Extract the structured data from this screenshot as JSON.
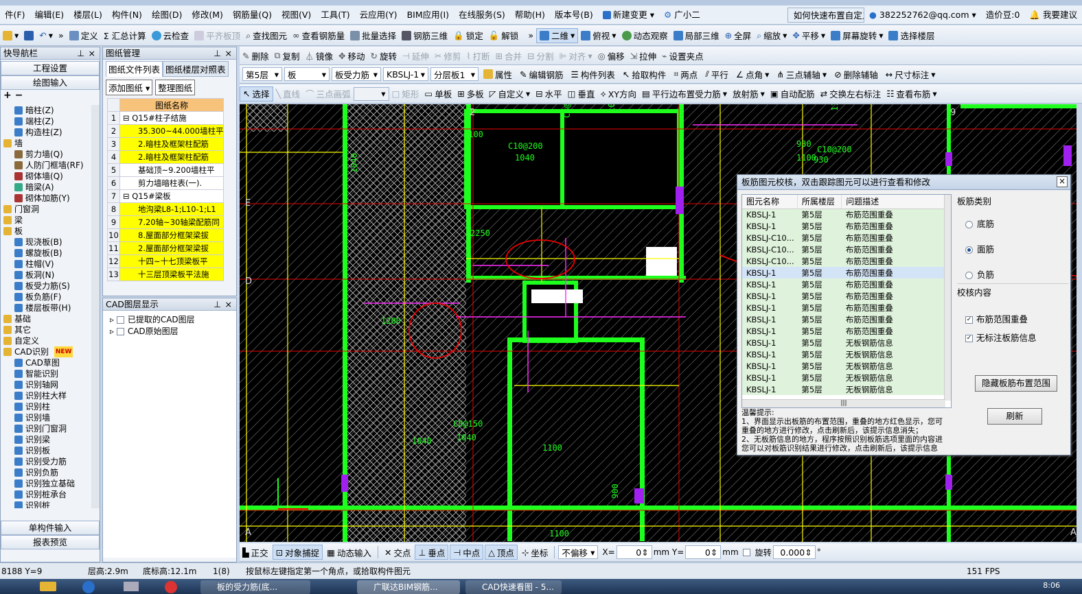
{
  "menu": [
    "件(F)",
    "编辑(E)",
    "楼层(L)",
    "构件(N)",
    "绘图(D)",
    "修改(M)",
    "钢筋量(Q)",
    "视图(V)",
    "工具(T)",
    "云应用(Y)",
    "BIM应用(I)",
    "在线服务(S)",
    "帮助(H)",
    "版本号(B)"
  ],
  "menu_extra": {
    "new_change": "新建变更",
    "assistant": "广小二",
    "tip": "如何快速布置自定义范...",
    "account": "382252762@qq.com",
    "price": "造价豆:0",
    "search": "我要建议"
  },
  "toolbar1": [
    "定义",
    "Σ 汇总计算",
    "云检查",
    "平齐板顶",
    "查找图元",
    "查看钢筋量",
    "批量选择",
    "钢筋三维",
    "锁定",
    "解锁",
    "二维",
    "俯视",
    "动态观察",
    "局部三维",
    "全屏",
    "缩放",
    "平移",
    "屏幕旋转",
    "选择楼层"
  ],
  "toolbar2": [
    "删除",
    "复制",
    "镜像",
    "移动",
    "旋转",
    "延伸",
    "修剪",
    "打断",
    "合并",
    "分割",
    "对齐",
    "偏移",
    "拉伸",
    "设置夹点"
  ],
  "toolbar3": {
    "floor": "第5层",
    "type": "板",
    "subtype": "板受力筋",
    "name": "KBSLJ-1",
    "layer": "分层板1",
    "buttons": [
      "属性",
      "编辑钢筋",
      "构件列表",
      "拾取构件",
      "两点",
      "平行",
      "点角",
      "三点辅轴",
      "删除辅轴",
      "尺寸标注"
    ]
  },
  "toolbar4": [
    "选择",
    "直线",
    "三点画弧",
    "矩形",
    "单板",
    "多板",
    "自定义",
    "水平",
    "垂直",
    "XY方向",
    "平行边布置受力筋",
    "放射筋",
    "自动配筋",
    "交换左右标注",
    "查看布筋"
  ],
  "nav": {
    "title": "快导航栏",
    "btn1": "工程设置",
    "btn2": "绘图输入",
    "btn3": "单构件输入",
    "btn4": "报表预览",
    "tree": [
      {
        "t": "暗柱(Z)",
        "l": 2,
        "c": "#3b7dc8"
      },
      {
        "t": "端柱(Z)",
        "l": 2,
        "c": "#3b7dc8"
      },
      {
        "t": "构造柱(Z)",
        "l": 2,
        "c": "#3b7dc8"
      },
      {
        "t": "墙",
        "l": 0,
        "c": "#e5b435"
      },
      {
        "t": "剪力墙(Q)",
        "l": 2,
        "c": "#8a6a3c"
      },
      {
        "t": "人防门框墙(RF)",
        "l": 2,
        "c": "#8a6a3c"
      },
      {
        "t": "砌体墙(Q)",
        "l": 2,
        "c": "#a33"
      },
      {
        "t": "暗梁(A)",
        "l": 2,
        "c": "#3a8"
      },
      {
        "t": "砌体加筋(Y)",
        "l": 2,
        "c": "#a33"
      },
      {
        "t": "门窗洞",
        "l": 0,
        "c": "#e5b435"
      },
      {
        "t": "梁",
        "l": 0,
        "c": "#e5b435"
      },
      {
        "t": "板",
        "l": 0,
        "c": "#e5b435"
      },
      {
        "t": "现浇板(B)",
        "l": 2,
        "c": "#3b7dc8"
      },
      {
        "t": "螺旋板(B)",
        "l": 2,
        "c": "#3b7dc8"
      },
      {
        "t": "柱帽(V)",
        "l": 2,
        "c": "#3b7dc8"
      },
      {
        "t": "板洞(N)",
        "l": 2,
        "c": "#3b7dc8"
      },
      {
        "t": "板受力筋(S)",
        "l": 2,
        "c": "#3b7dc8"
      },
      {
        "t": "板负筋(F)",
        "l": 2,
        "c": "#3b7dc8"
      },
      {
        "t": "楼层板带(H)",
        "l": 2,
        "c": "#3b7dc8"
      },
      {
        "t": "基础",
        "l": 0,
        "c": "#e5b435"
      },
      {
        "t": "其它",
        "l": 0,
        "c": "#e5b435"
      },
      {
        "t": "自定义",
        "l": 0,
        "c": "#e5b435"
      },
      {
        "t": "CAD识别",
        "l": 0,
        "c": "#e5b435",
        "badge": "NEW"
      },
      {
        "t": "CAD草图",
        "l": 2,
        "c": "#3b7dc8"
      },
      {
        "t": "智能识别",
        "l": 2,
        "c": "#3b7dc8"
      },
      {
        "t": "识别轴网",
        "l": 2,
        "c": "#3b7dc8"
      },
      {
        "t": "识别柱大样",
        "l": 2,
        "c": "#3b7dc8"
      },
      {
        "t": "识别柱",
        "l": 2,
        "c": "#3b7dc8"
      },
      {
        "t": "识别墙",
        "l": 2,
        "c": "#3b7dc8"
      },
      {
        "t": "识别门窗洞",
        "l": 2,
        "c": "#3b7dc8"
      },
      {
        "t": "识别梁",
        "l": 2,
        "c": "#3b7dc8"
      },
      {
        "t": "识别板",
        "l": 2,
        "c": "#3b7dc8"
      },
      {
        "t": "识别受力筋",
        "l": 2,
        "c": "#3b7dc8"
      },
      {
        "t": "识别负筋",
        "l": 2,
        "c": "#3b7dc8"
      },
      {
        "t": "识别独立基础",
        "l": 2,
        "c": "#3b7dc8"
      },
      {
        "t": "识别桩承台",
        "l": 2,
        "c": "#3b7dc8"
      },
      {
        "t": "识别桩",
        "l": 2,
        "c": "#3b7dc8"
      }
    ]
  },
  "drawings": {
    "title": "图纸管理",
    "tab1": "图纸文件列表",
    "tab2": "图纸楼层对照表",
    "add": "添加图纸",
    "organize": "整理图纸",
    "col": "图纸名称",
    "rows": [
      {
        "n": "1",
        "t": "Q15#柱子结施",
        "g": true
      },
      {
        "n": "2",
        "t": "35.300~44.000墙柱平",
        "y": true
      },
      {
        "n": "3",
        "t": "2.暗柱及框架柱配筋",
        "y": true
      },
      {
        "n": "4",
        "t": "2.暗柱及框架柱配筋",
        "y": true
      },
      {
        "n": "5",
        "t": "基础顶~9.200墙柱平"
      },
      {
        "n": "6",
        "t": "剪力墙暗柱表(一)."
      },
      {
        "n": "7",
        "t": "Q15#梁板",
        "g": true
      },
      {
        "n": "8",
        "t": "地沟梁L8-1;L10-1;L1",
        "y": true
      },
      {
        "n": "9",
        "t": "7.20轴~30轴梁配筋同",
        "y": true
      },
      {
        "n": "10",
        "t": "8.屋面部分框架梁拔",
        "y": true
      },
      {
        "n": "11",
        "t": "2.屋面部分框架梁拔",
        "y": true
      },
      {
        "n": "12",
        "t": "十四~十七顶梁板平",
        "y": true
      },
      {
        "n": "13",
        "t": "十三层顶梁板平法施",
        "y": true
      }
    ]
  },
  "cad_layers": {
    "title": "CAD图层显示",
    "items": [
      "已提取的CAD图层",
      "CAD原始图层"
    ]
  },
  "dialog": {
    "title": "板筋图元校核，双击跟踪图元可以进行查看和修改",
    "cols": [
      "图元名称",
      "所属楼层",
      "问题描述"
    ],
    "rows": [
      [
        "KBSLJ-1",
        "第5层",
        "布筋范围重叠"
      ],
      [
        "KBSLJ-1",
        "第5层",
        "布筋范围重叠"
      ],
      [
        "KBSLJ-C10...",
        "第5层",
        "布筋范围重叠"
      ],
      [
        "KBSLJ-C10...",
        "第5层",
        "布筋范围重叠"
      ],
      [
        "KBSLJ-C10...",
        "第5层",
        "布筋范围重叠"
      ],
      [
        "KBSLJ-1",
        "第5层",
        "布筋范围重叠"
      ],
      [
        "KBSLJ-1",
        "第5层",
        "布筋范围重叠"
      ],
      [
        "KBSLJ-1",
        "第5层",
        "布筋范围重叠"
      ],
      [
        "KBSLJ-1",
        "第5层",
        "布筋范围重叠"
      ],
      [
        "KBSLJ-1",
        "第5层",
        "布筋范围重叠"
      ],
      [
        "KBSLJ-1",
        "第5层",
        "布筋范围重叠"
      ],
      [
        "KBSLJ-1",
        "第5层",
        "无板钢筋信息"
      ],
      [
        "KBSLJ-1",
        "第5层",
        "无板钢筋信息"
      ],
      [
        "KBSLJ-1",
        "第5层",
        "无板钢筋信息"
      ],
      [
        "KBSLJ-1",
        "第5层",
        "无板钢筋信息"
      ],
      [
        "KBSLJ-1",
        "第5层",
        "无板钢筋信息"
      ]
    ],
    "selected_row": 5,
    "cat_label": "板筋类别",
    "radios": [
      "底筋",
      "面筋",
      "负筋"
    ],
    "radio_selected": 1,
    "content_label": "校核内容",
    "checks": [
      "布筋范围重叠",
      "无标注板筋信息"
    ],
    "hide_btn": "隐藏板筋布置范围",
    "refresh_btn": "刷新",
    "tips_title": "温馨提示:",
    "tips": [
      "1、界面显示出板筋的布置范围，重叠的地方红色显示，您可",
      "重叠的地方进行修改，点击刷新后，该提示信息消失；",
      "2、无板筋信息的地方，程序按照识别板筋选项里面的内容进",
      "您可以对板筋识别结果进行修改，点击刷新后，该提示信息"
    ]
  },
  "bottom_toolbar": {
    "items": [
      "正交",
      "对象捕捉",
      "动态输入",
      "交点",
      "垂点",
      "中点",
      "顶点",
      "坐标"
    ],
    "offset": "不偏移",
    "x_label": "X=",
    "x": "0",
    "y_label": "mm Y=",
    "y": "0",
    "mm": "mm",
    "rotate": "旋转",
    "rot": "0.000"
  },
  "status": {
    "coords": "8188 Y=9",
    "floor_h": "层高:2.9m",
    "base_h": "底标高:12.1m",
    "count": "1(8)",
    "hint": "按鼠标左键指定第一个角点，或拾取构件图元",
    "fps": "151 FPS"
  },
  "taskbar": {
    "t1": "板的受力筋(底...",
    "t2": "广联达BIM钢筋...",
    "t3": "CAD快速看图 - 5...",
    "time": "8:06"
  },
  "canvas_labels": [
    "1100",
    "C10@200",
    "1040",
    "C8@150",
    "1040",
    "930",
    "1100",
    "1040",
    "2250",
    "1200",
    "1040",
    "C8@150",
    "1040",
    "1100",
    "1100",
    "1100",
    "150",
    "900",
    "C8@150",
    "900",
    "C10@200",
    "930"
  ]
}
